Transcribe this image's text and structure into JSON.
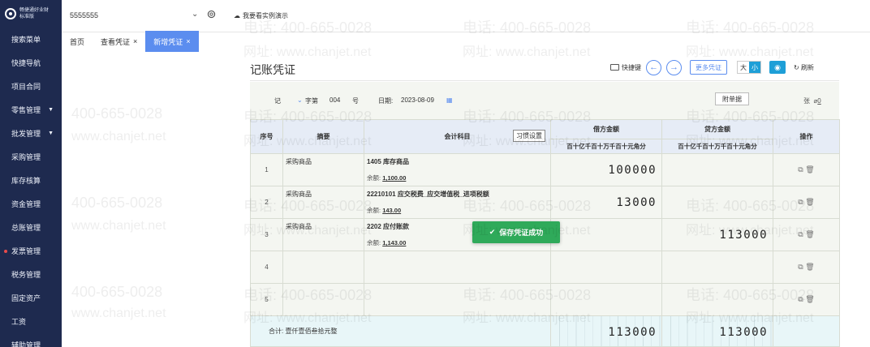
{
  "logo": {
    "line1": "畅捷通好业财",
    "line2": "标准版"
  },
  "sidebar": {
    "items": [
      {
        "label": "搜索菜单"
      },
      {
        "label": "快捷导航"
      },
      {
        "label": "项目合同"
      },
      {
        "label": "零售管理",
        "has_children": true
      },
      {
        "label": "批发管理",
        "has_children": true
      },
      {
        "label": "采购管理"
      },
      {
        "label": "库存核算"
      },
      {
        "label": "资金管理"
      },
      {
        "label": "总账管理"
      },
      {
        "label": "发票管理",
        "badge": "dot"
      },
      {
        "label": "税务管理"
      },
      {
        "label": "固定资产"
      },
      {
        "label": "工资"
      },
      {
        "label": "辅助管理"
      }
    ]
  },
  "topbar": {
    "account": "5555555",
    "demo_label": "我要看实例演示"
  },
  "tabs": [
    {
      "label": "首页",
      "closable": false,
      "active": false
    },
    {
      "label": "查看凭证",
      "closable": true,
      "active": false
    },
    {
      "label": "新增凭证",
      "closable": true,
      "active": true
    }
  ],
  "page": {
    "title": "记账凭证",
    "toolbar": {
      "shortcut": "快捷键",
      "more": "更多凭证",
      "size_big": "大",
      "size_small": "小",
      "refresh": "刷新"
    }
  },
  "voucher": {
    "type": "记",
    "word": "字第",
    "number": "004",
    "number_suffix": "号",
    "date_label": "日期:",
    "date": "2023-08-09",
    "attach_label": "附单据",
    "attach_count_suffix": "张",
    "attach_count": "0",
    "columns": {
      "seq": "序号",
      "summary": "摘要",
      "account": "会计科目",
      "habit": "习惯设置",
      "debit": "借方金额",
      "credit": "贷方金额",
      "ops": "操作",
      "digits": [
        "百",
        "十",
        "亿",
        "千",
        "百",
        "十",
        "万",
        "千",
        "百",
        "十",
        "元",
        "角",
        "分"
      ]
    },
    "rows": [
      {
        "seq": "1",
        "summary": "采购商品",
        "account": "1405 库存商品",
        "balance_label": "余额:",
        "balance": "1,100.00",
        "debit": "100000",
        "credit": ""
      },
      {
        "seq": "2",
        "summary": "采购商品",
        "account": "22210101 应交税费_应交增值税_进项税额",
        "balance_label": "余额:",
        "balance": "143.00",
        "debit": "13000",
        "credit": ""
      },
      {
        "seq": "3",
        "summary": "采购商品",
        "account": "2202 应付账款",
        "balance_label": "余额:",
        "balance": "1,143.00",
        "debit": "",
        "credit": "113000"
      },
      {
        "seq": "4",
        "summary": "",
        "account": "",
        "balance_label": "",
        "balance": "",
        "debit": "",
        "credit": ""
      },
      {
        "seq": "5",
        "summary": "",
        "account": "",
        "balance_label": "",
        "balance": "",
        "debit": "",
        "credit": ""
      }
    ],
    "total": {
      "label": "合计:  壹仟壹佰叁拾元整",
      "debit": "113000",
      "credit": "113000"
    }
  },
  "toast": {
    "text": "保存凭证成功"
  },
  "watermark": {
    "phone": "电话: 400-665-0028",
    "url": "网址: www.chanjet.net",
    "phone_short": "400-665-0028",
    "url_short": "www.chanjet.net"
  }
}
